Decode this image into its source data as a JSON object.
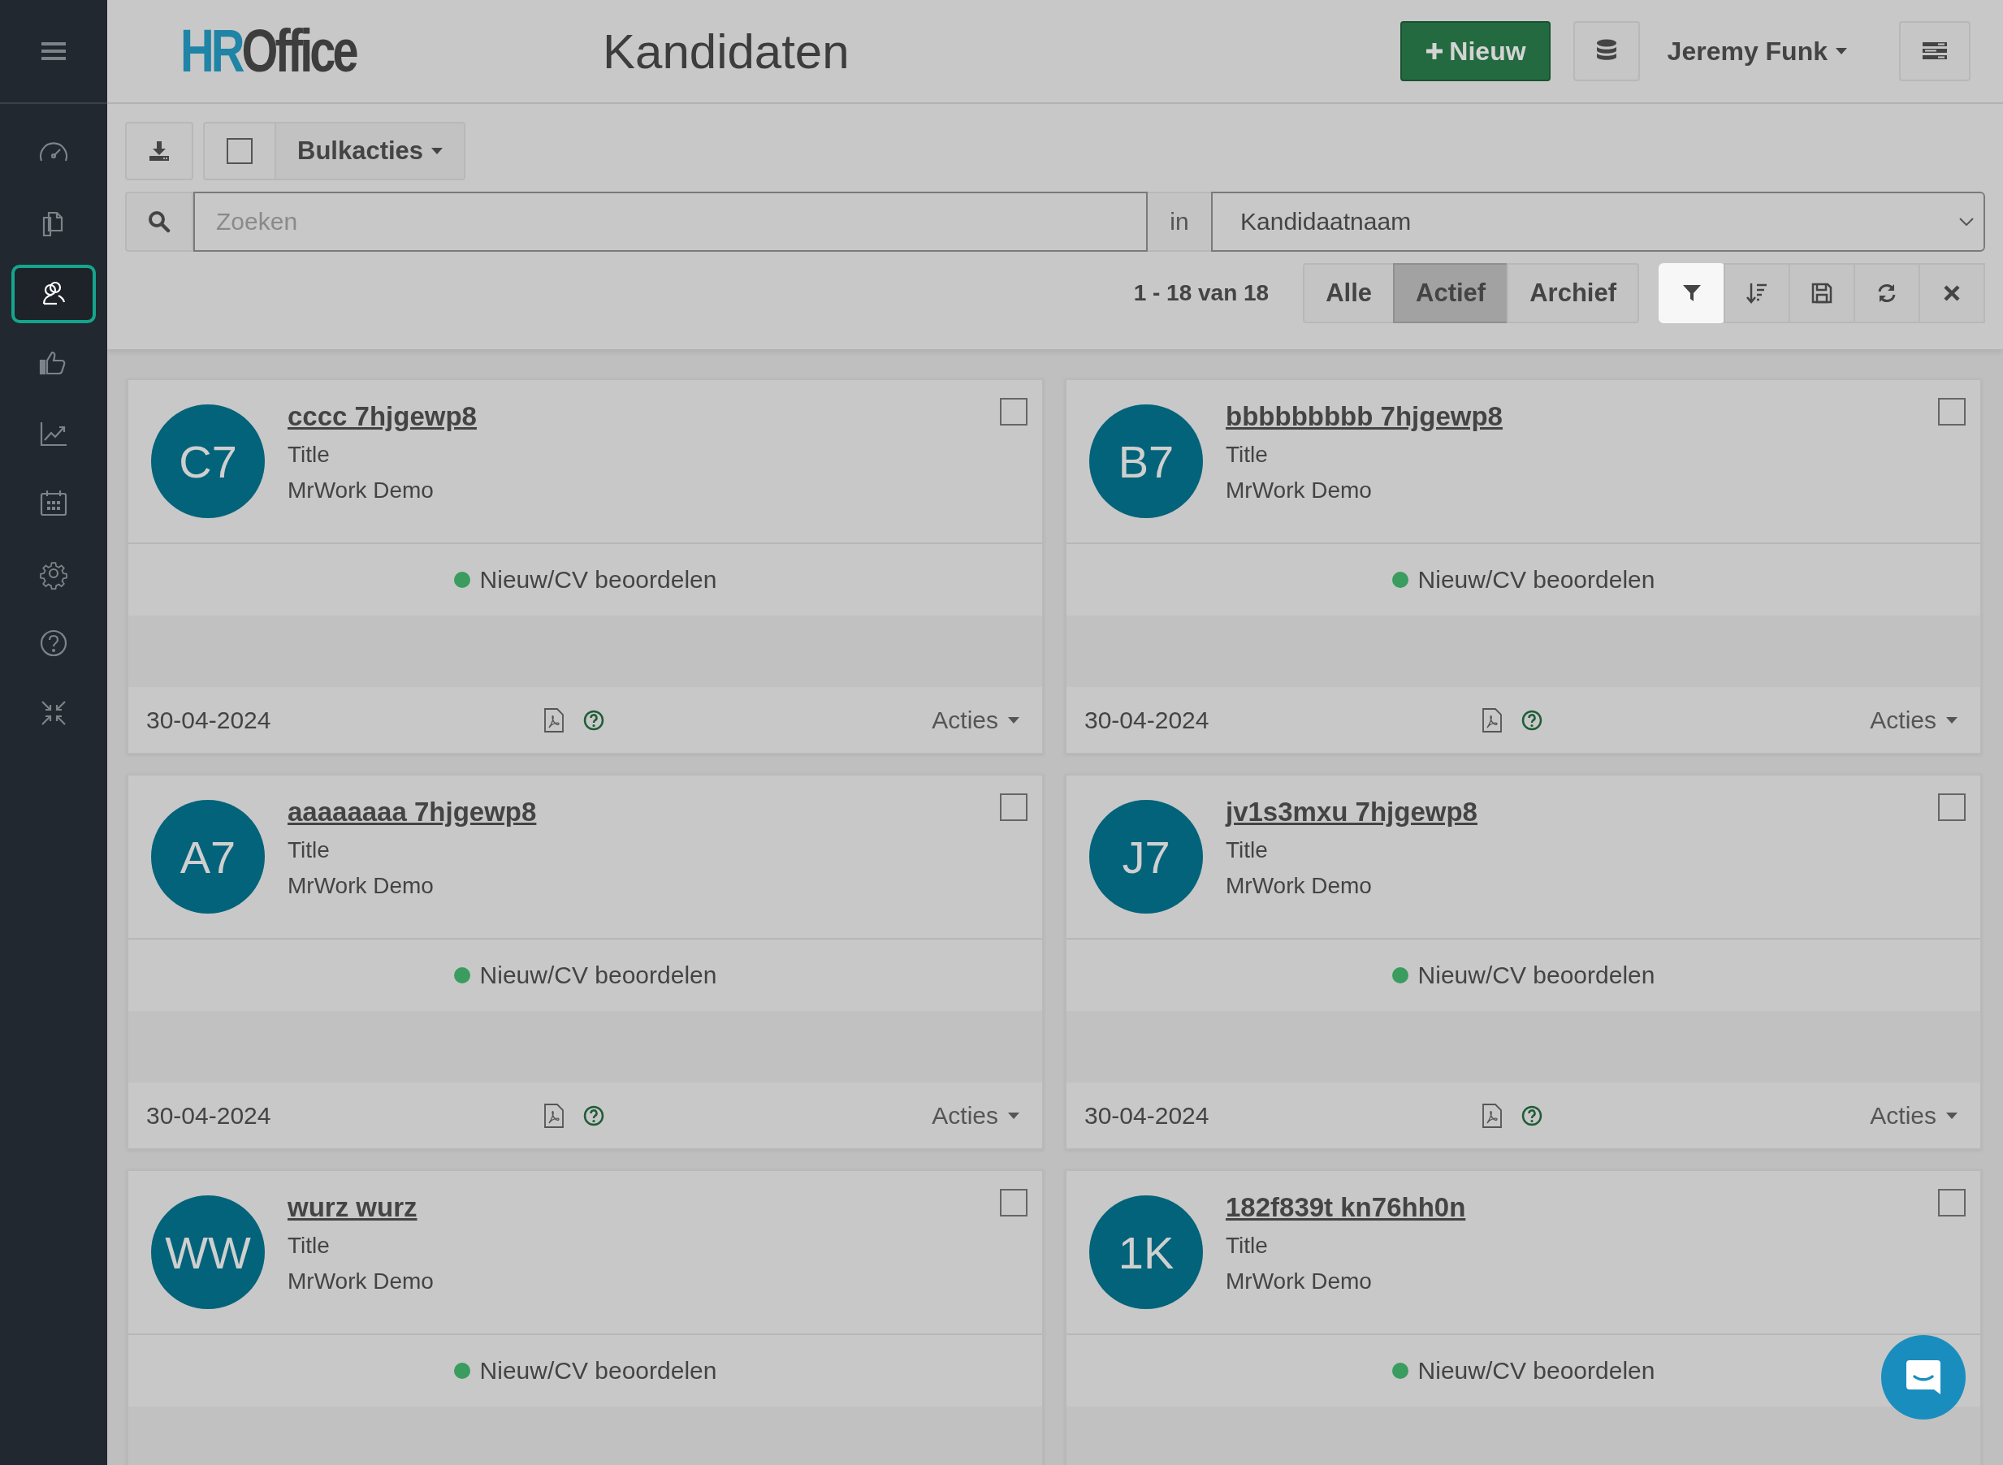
{
  "sidebar": {
    "items": [
      {
        "selected": false
      },
      {
        "selected": false
      },
      {
        "selected": true
      },
      {
        "selected": false
      },
      {
        "selected": false
      },
      {
        "selected": false
      },
      {
        "selected": false
      },
      {
        "selected": false
      },
      {
        "selected": false
      }
    ]
  },
  "header": {
    "logo_prefix": "HR",
    "logo_name": "Office",
    "title": "Kandidaten",
    "new_button": "Nieuw",
    "user": "Jeremy Funk"
  },
  "toolbar": {
    "select_all_checked": false,
    "bulk_actions": "Bulkacties",
    "search": {
      "placeholder": "Zoeken"
    },
    "in_label": "in",
    "search_field": "Kandidaatnaam",
    "count": "1 - 18 van 18",
    "segments": [
      {
        "label": "Alle",
        "selected": false
      },
      {
        "label": "Actief",
        "selected": true
      },
      {
        "label": "Archief",
        "selected": false
      }
    ],
    "tools": [
      {
        "selected": true
      },
      {
        "selected": false
      },
      {
        "selected": false
      },
      {
        "selected": false
      },
      {
        "selected": false
      }
    ]
  },
  "cards": [
    {
      "initials": "C7",
      "name": "cccc 7hjgewp8",
      "title": "Title",
      "company": "MrWork Demo",
      "checked": false,
      "status": {
        "label": "Nieuw/CV beoordelen",
        "color": "#3a9c5e"
      },
      "date": "30-04-2024",
      "actions": "Acties"
    },
    {
      "initials": "B7",
      "name": "bbbbbbbbb 7hjgewp8",
      "title": "Title",
      "company": "MrWork Demo",
      "checked": false,
      "status": {
        "label": "Nieuw/CV beoordelen",
        "color": "#3a9c5e"
      },
      "date": "30-04-2024",
      "actions": "Acties"
    },
    {
      "initials": "A7",
      "name": "aaaaaaaa 7hjgewp8",
      "title": "Title",
      "company": "MrWork Demo",
      "checked": false,
      "status": {
        "label": "Nieuw/CV beoordelen",
        "color": "#3a9c5e"
      },
      "date": "30-04-2024",
      "actions": "Acties"
    },
    {
      "initials": "J7",
      "name": "jv1s3mxu 7hjgewp8",
      "title": "Title",
      "company": "MrWork Demo",
      "checked": false,
      "status": {
        "label": "Nieuw/CV beoordelen",
        "color": "#3a9c5e"
      },
      "date": "30-04-2024",
      "actions": "Acties"
    },
    {
      "initials": "WW",
      "name": "wurz wurz",
      "title": "Title",
      "company": "MrWork Demo",
      "checked": false,
      "status": {
        "label": "Nieuw/CV beoordelen",
        "color": "#3a9c5e"
      }
    },
    {
      "initials": "1K",
      "name": "182f839t kn76hh0n",
      "title": "Title",
      "company": "MrWork Demo",
      "checked": false,
      "status": {
        "label": "Nieuw/CV beoordelen",
        "color": "#3a9c5e"
      }
    }
  ]
}
